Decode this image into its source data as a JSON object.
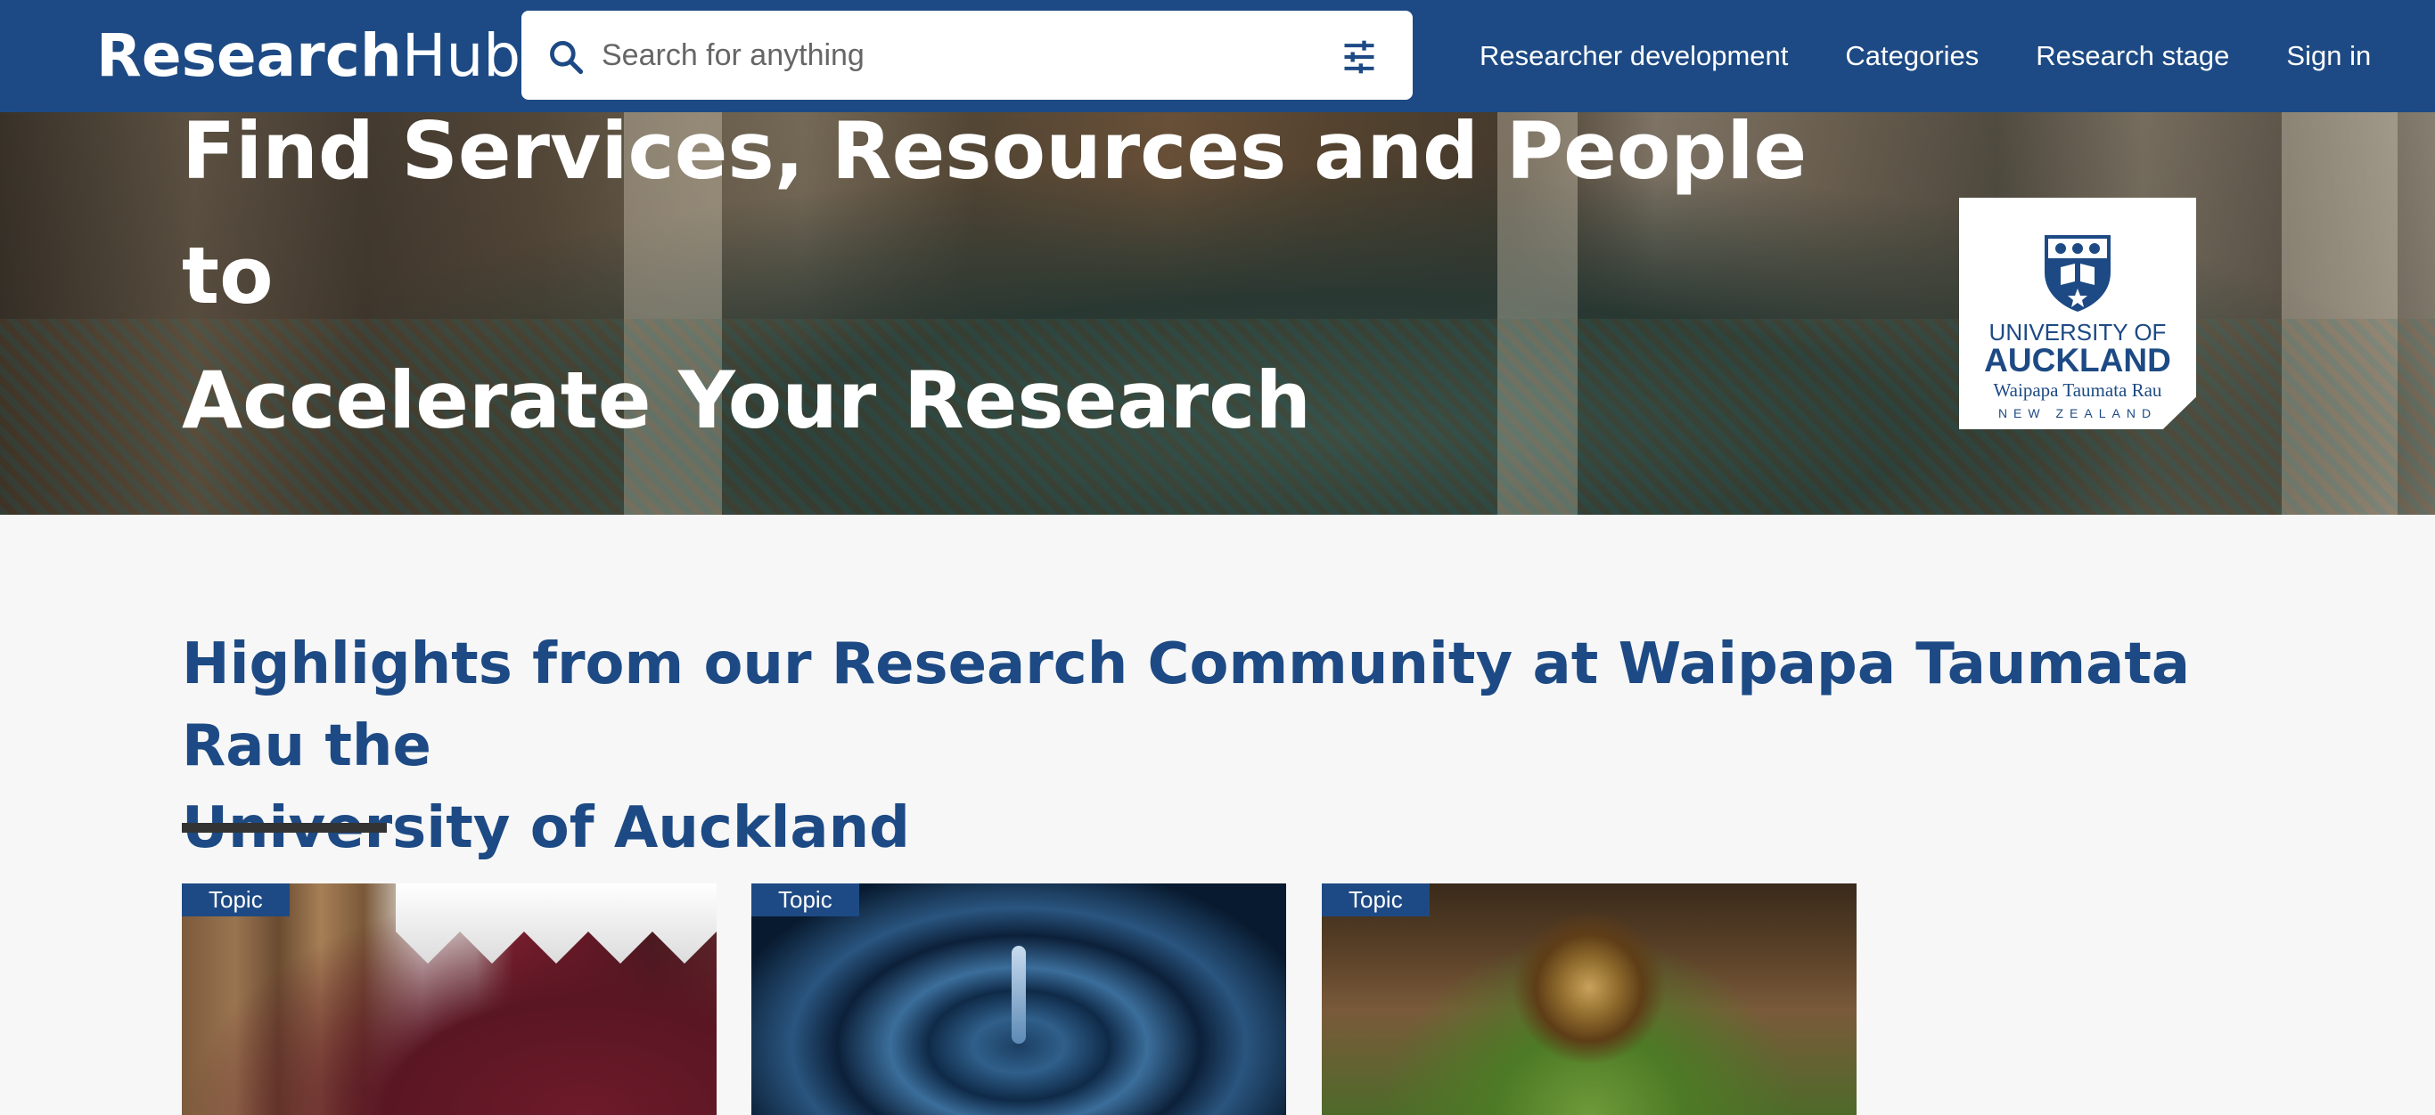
{
  "header": {
    "brand_bold": "Research",
    "brand_light": "Hub",
    "search_placeholder": "Search for anything",
    "nav": [
      {
        "label": "Researcher development"
      },
      {
        "label": "Categories"
      },
      {
        "label": "Research stage"
      },
      {
        "label": "Sign in"
      }
    ]
  },
  "hero": {
    "title_line1": "Find Services, Resources and People to",
    "title_line2": "Accelerate Your Research",
    "logo": {
      "line1": "UNIVERSITY OF",
      "line2": "AUCKLAND",
      "line3": "Waipapa Taumata Rau",
      "line4": "NEW ZEALAND"
    }
  },
  "highlights": {
    "title_line1": "Highlights from our Research Community at Waipapa Taumata Rau the",
    "title_line2": "University of Auckland",
    "cards": [
      {
        "tag": "Topic"
      },
      {
        "tag": "Topic"
      },
      {
        "tag": "Topic"
      }
    ]
  },
  "colors": {
    "primary": "#1d4a84",
    "background": "#f7f7f7",
    "underline": "#333333"
  },
  "icons": {
    "search": "search-icon",
    "filter": "filter-sliders-icon"
  }
}
